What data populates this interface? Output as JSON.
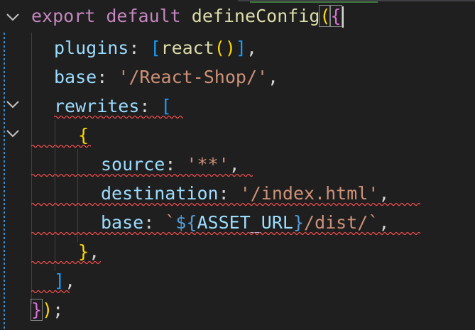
{
  "editor": {
    "lines": [
      {
        "tokens": [
          "export",
          "default",
          "defineConfig",
          "(",
          "{"
        ]
      },
      {
        "tokens": [
          "plugins",
          ": ",
          "[",
          "react",
          "(",
          ")",
          "]",
          ","
        ]
      },
      {
        "tokens": [
          "base",
          ": ",
          "'/React-Shop/'",
          ","
        ]
      },
      {
        "tokens": [
          "rewrites",
          ": ",
          "["
        ]
      },
      {
        "tokens": [
          "{"
        ]
      },
      {
        "tokens": [
          "source",
          ": ",
          "'**'",
          ","
        ]
      },
      {
        "tokens": [
          "destination",
          ": ",
          "'/index.html'",
          ","
        ]
      },
      {
        "tokens": [
          "base",
          ": ",
          "`",
          "${",
          "ASSET_URL",
          "}",
          "/dist/`",
          ","
        ]
      },
      {
        "tokens": [
          "}",
          ","
        ]
      },
      {
        "tokens": [
          "]",
          ","
        ]
      },
      {
        "tokens": [
          "}",
          ")",
          ";"
        ]
      }
    ]
  },
  "colors": {
    "background": "#1f1f1f",
    "keyword": "#c586c0",
    "function": "#dcdcaa",
    "property": "#9cdcfe",
    "string": "#ce9178",
    "bracket_level1": "#ffd700",
    "bracket_level2": "#da70d6",
    "bracket_level3": "#179fff",
    "error_squiggle": "#f14c4c"
  },
  "icons": [
    "chevron-down-icon"
  ]
}
